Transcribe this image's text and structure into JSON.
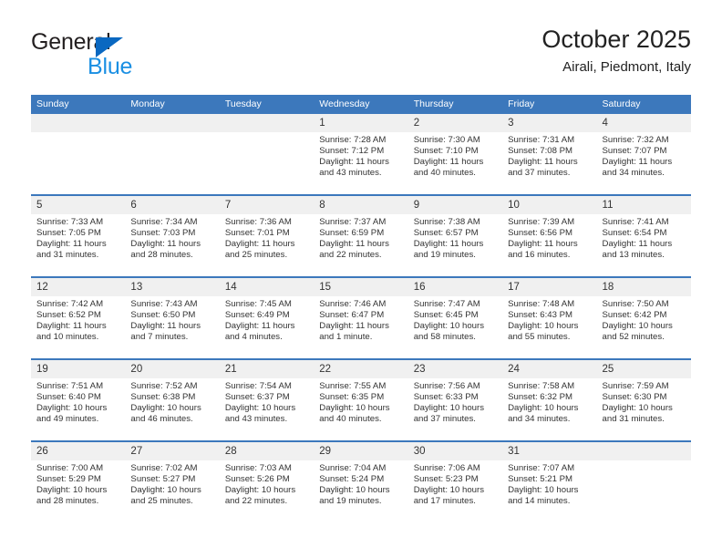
{
  "brand": {
    "name_part1": "General",
    "name_part2": "Blue",
    "triangle_color": "#0a68c1",
    "blue_color": "#1a8fe3"
  },
  "header": {
    "title": "October 2025",
    "subtitle": "Airali, Piedmont, Italy"
  },
  "theme": {
    "header_blue": "#3c78bc",
    "daynum_band": "#f0f0f0",
    "text": "#333333"
  },
  "labels": {
    "sunrise_prefix": "Sunrise:",
    "sunset_prefix": "Sunset:",
    "daylight_prefix": "Daylight:"
  },
  "weekday_headers": [
    "Sunday",
    "Monday",
    "Tuesday",
    "Wednesday",
    "Thursday",
    "Friday",
    "Saturday"
  ],
  "weeks": [
    [
      {
        "day": "",
        "empty": true
      },
      {
        "day": "",
        "empty": true
      },
      {
        "day": "",
        "empty": true
      },
      {
        "day": "1",
        "sunrise": "Sunrise: 7:28 AM",
        "sunset": "Sunset: 7:12 PM",
        "daylight_line1": "Daylight: 11 hours",
        "daylight_line2": "and 43 minutes."
      },
      {
        "day": "2",
        "sunrise": "Sunrise: 7:30 AM",
        "sunset": "Sunset: 7:10 PM",
        "daylight_line1": "Daylight: 11 hours",
        "daylight_line2": "and 40 minutes."
      },
      {
        "day": "3",
        "sunrise": "Sunrise: 7:31 AM",
        "sunset": "Sunset: 7:08 PM",
        "daylight_line1": "Daylight: 11 hours",
        "daylight_line2": "and 37 minutes."
      },
      {
        "day": "4",
        "sunrise": "Sunrise: 7:32 AM",
        "sunset": "Sunset: 7:07 PM",
        "daylight_line1": "Daylight: 11 hours",
        "daylight_line2": "and 34 minutes."
      }
    ],
    [
      {
        "day": "5",
        "sunrise": "Sunrise: 7:33 AM",
        "sunset": "Sunset: 7:05 PM",
        "daylight_line1": "Daylight: 11 hours",
        "daylight_line2": "and 31 minutes."
      },
      {
        "day": "6",
        "sunrise": "Sunrise: 7:34 AM",
        "sunset": "Sunset: 7:03 PM",
        "daylight_line1": "Daylight: 11 hours",
        "daylight_line2": "and 28 minutes."
      },
      {
        "day": "7",
        "sunrise": "Sunrise: 7:36 AM",
        "sunset": "Sunset: 7:01 PM",
        "daylight_line1": "Daylight: 11 hours",
        "daylight_line2": "and 25 minutes."
      },
      {
        "day": "8",
        "sunrise": "Sunrise: 7:37 AM",
        "sunset": "Sunset: 6:59 PM",
        "daylight_line1": "Daylight: 11 hours",
        "daylight_line2": "and 22 minutes."
      },
      {
        "day": "9",
        "sunrise": "Sunrise: 7:38 AM",
        "sunset": "Sunset: 6:57 PM",
        "daylight_line1": "Daylight: 11 hours",
        "daylight_line2": "and 19 minutes."
      },
      {
        "day": "10",
        "sunrise": "Sunrise: 7:39 AM",
        "sunset": "Sunset: 6:56 PM",
        "daylight_line1": "Daylight: 11 hours",
        "daylight_line2": "and 16 minutes."
      },
      {
        "day": "11",
        "sunrise": "Sunrise: 7:41 AM",
        "sunset": "Sunset: 6:54 PM",
        "daylight_line1": "Daylight: 11 hours",
        "daylight_line2": "and 13 minutes."
      }
    ],
    [
      {
        "day": "12",
        "sunrise": "Sunrise: 7:42 AM",
        "sunset": "Sunset: 6:52 PM",
        "daylight_line1": "Daylight: 11 hours",
        "daylight_line2": "and 10 minutes."
      },
      {
        "day": "13",
        "sunrise": "Sunrise: 7:43 AM",
        "sunset": "Sunset: 6:50 PM",
        "daylight_line1": "Daylight: 11 hours",
        "daylight_line2": "and 7 minutes."
      },
      {
        "day": "14",
        "sunrise": "Sunrise: 7:45 AM",
        "sunset": "Sunset: 6:49 PM",
        "daylight_line1": "Daylight: 11 hours",
        "daylight_line2": "and 4 minutes."
      },
      {
        "day": "15",
        "sunrise": "Sunrise: 7:46 AM",
        "sunset": "Sunset: 6:47 PM",
        "daylight_line1": "Daylight: 11 hours",
        "daylight_line2": "and 1 minute."
      },
      {
        "day": "16",
        "sunrise": "Sunrise: 7:47 AM",
        "sunset": "Sunset: 6:45 PM",
        "daylight_line1": "Daylight: 10 hours",
        "daylight_line2": "and 58 minutes."
      },
      {
        "day": "17",
        "sunrise": "Sunrise: 7:48 AM",
        "sunset": "Sunset: 6:43 PM",
        "daylight_line1": "Daylight: 10 hours",
        "daylight_line2": "and 55 minutes."
      },
      {
        "day": "18",
        "sunrise": "Sunrise: 7:50 AM",
        "sunset": "Sunset: 6:42 PM",
        "daylight_line1": "Daylight: 10 hours",
        "daylight_line2": "and 52 minutes."
      }
    ],
    [
      {
        "day": "19",
        "sunrise": "Sunrise: 7:51 AM",
        "sunset": "Sunset: 6:40 PM",
        "daylight_line1": "Daylight: 10 hours",
        "daylight_line2": "and 49 minutes."
      },
      {
        "day": "20",
        "sunrise": "Sunrise: 7:52 AM",
        "sunset": "Sunset: 6:38 PM",
        "daylight_line1": "Daylight: 10 hours",
        "daylight_line2": "and 46 minutes."
      },
      {
        "day": "21",
        "sunrise": "Sunrise: 7:54 AM",
        "sunset": "Sunset: 6:37 PM",
        "daylight_line1": "Daylight: 10 hours",
        "daylight_line2": "and 43 minutes."
      },
      {
        "day": "22",
        "sunrise": "Sunrise: 7:55 AM",
        "sunset": "Sunset: 6:35 PM",
        "daylight_line1": "Daylight: 10 hours",
        "daylight_line2": "and 40 minutes."
      },
      {
        "day": "23",
        "sunrise": "Sunrise: 7:56 AM",
        "sunset": "Sunset: 6:33 PM",
        "daylight_line1": "Daylight: 10 hours",
        "daylight_line2": "and 37 minutes."
      },
      {
        "day": "24",
        "sunrise": "Sunrise: 7:58 AM",
        "sunset": "Sunset: 6:32 PM",
        "daylight_line1": "Daylight: 10 hours",
        "daylight_line2": "and 34 minutes."
      },
      {
        "day": "25",
        "sunrise": "Sunrise: 7:59 AM",
        "sunset": "Sunset: 6:30 PM",
        "daylight_line1": "Daylight: 10 hours",
        "daylight_line2": "and 31 minutes."
      }
    ],
    [
      {
        "day": "26",
        "sunrise": "Sunrise: 7:00 AM",
        "sunset": "Sunset: 5:29 PM",
        "daylight_line1": "Daylight: 10 hours",
        "daylight_line2": "and 28 minutes."
      },
      {
        "day": "27",
        "sunrise": "Sunrise: 7:02 AM",
        "sunset": "Sunset: 5:27 PM",
        "daylight_line1": "Daylight: 10 hours",
        "daylight_line2": "and 25 minutes."
      },
      {
        "day": "28",
        "sunrise": "Sunrise: 7:03 AM",
        "sunset": "Sunset: 5:26 PM",
        "daylight_line1": "Daylight: 10 hours",
        "daylight_line2": "and 22 minutes."
      },
      {
        "day": "29",
        "sunrise": "Sunrise: 7:04 AM",
        "sunset": "Sunset: 5:24 PM",
        "daylight_line1": "Daylight: 10 hours",
        "daylight_line2": "and 19 minutes."
      },
      {
        "day": "30",
        "sunrise": "Sunrise: 7:06 AM",
        "sunset": "Sunset: 5:23 PM",
        "daylight_line1": "Daylight: 10 hours",
        "daylight_line2": "and 17 minutes."
      },
      {
        "day": "31",
        "sunrise": "Sunrise: 7:07 AM",
        "sunset": "Sunset: 5:21 PM",
        "daylight_line1": "Daylight: 10 hours",
        "daylight_line2": "and 14 minutes."
      },
      {
        "day": "",
        "empty": true
      }
    ]
  ]
}
